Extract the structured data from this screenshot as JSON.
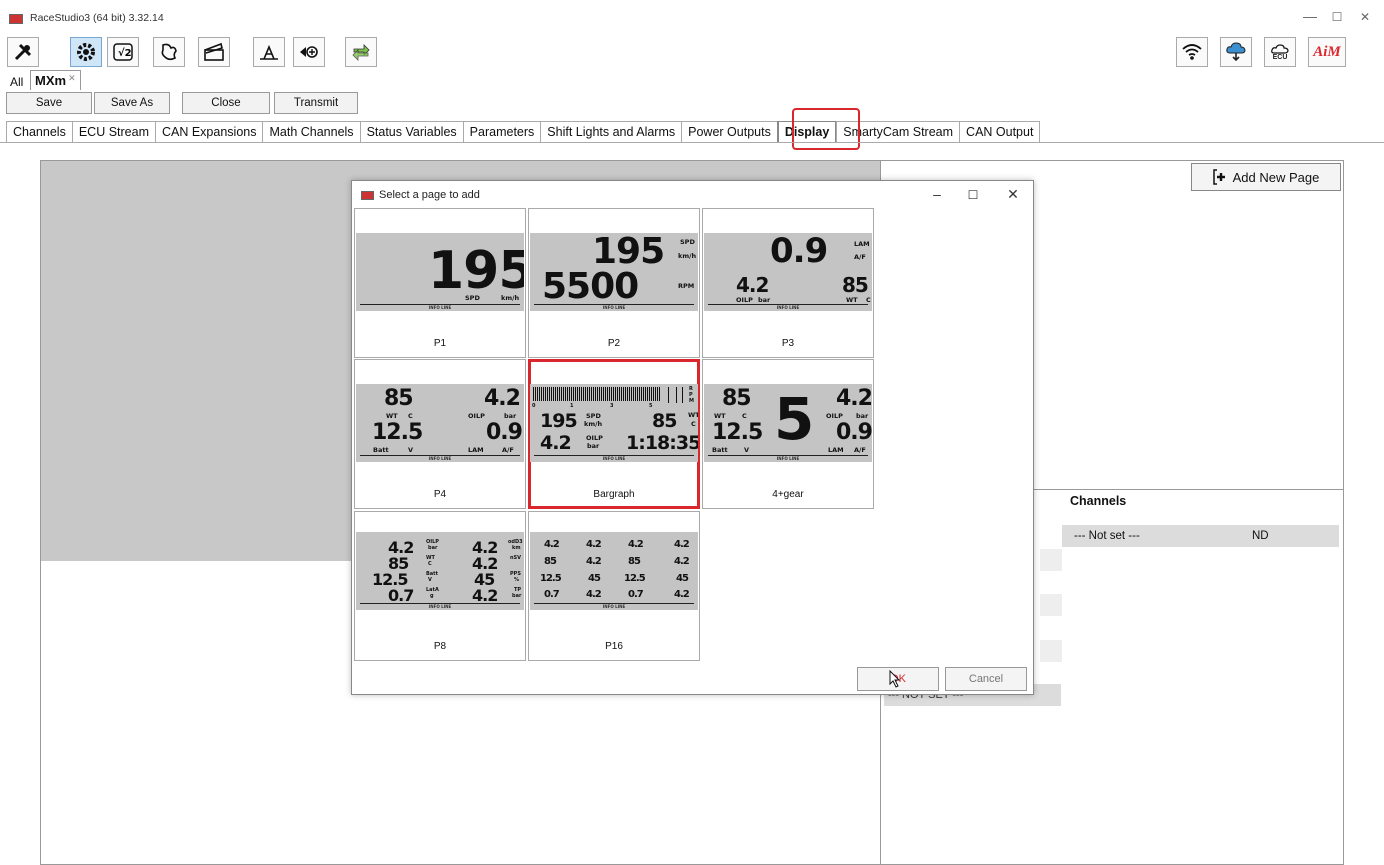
{
  "window": {
    "title": "RaceStudio3 (64 bit) 3.32.14",
    "minimize": "—",
    "maximize": "☐",
    "close": "✕"
  },
  "toolbar": {
    "left_icons": [
      "wrench-screwdriver-icon",
      "gear-icon",
      "math-function-icon",
      "track-map-icon",
      "video-clapper-icon",
      "dashboard-data-icon",
      "add-device-icon",
      "transfer-arrows-icon"
    ],
    "right_icons": [
      "wifi-icon",
      "cloud-download-icon",
      "ecu-cloud-icon",
      "aim-logo"
    ],
    "ecu_label": "ECU",
    "brand": "AiM"
  },
  "doc_tabs": {
    "all": "All",
    "active": "MXm",
    "close": "✕"
  },
  "actions": {
    "save": "Save",
    "save_as": "Save As",
    "close": "Close",
    "transmit": "Transmit"
  },
  "config_tabs": [
    "Channels",
    "ECU Stream",
    "CAN Expansions",
    "Math Channels",
    "Status Variables",
    "Parameters",
    "Shift Lights and Alarms",
    "Power Outputs",
    "Display",
    "SmartyCam Stream",
    "CAN Output"
  ],
  "active_config_tab": "Display",
  "right_panel": {
    "add_page": "Add New Page",
    "channels_title": "Channels",
    "channel_row": {
      "name": "--- Not set ---",
      "value": "ND"
    },
    "not_set": "--- NOT SET ---"
  },
  "dialog": {
    "title": "Select a page to add",
    "ok": "OK",
    "cancel": "Cancel",
    "info_line": "INFO LINE",
    "pages": [
      {
        "label": "P1",
        "selected": false
      },
      {
        "label": "P2",
        "selected": false
      },
      {
        "label": "P3",
        "selected": false
      },
      {
        "label": "P4",
        "selected": false
      },
      {
        "label": "Bargraph",
        "selected": true
      },
      {
        "label": "4+gear",
        "selected": false
      },
      {
        "label": "P8",
        "selected": false
      },
      {
        "label": "P16",
        "selected": false
      }
    ],
    "p1": {
      "value": "195",
      "u1": "SPD",
      "u2": "km/h"
    },
    "p2": {
      "v1": "195",
      "v2": "5500",
      "u1": "SPD",
      "u2": "km/h",
      "u3": "RPM"
    },
    "p3": {
      "v1": "0.9",
      "v2": "4.2",
      "v3": "85",
      "u1": "LAM",
      "u2": "A/F",
      "u3": "OILP",
      "u4": "bar",
      "u5": "WT",
      "u6": "C"
    },
    "p4": {
      "a": "85",
      "au": "WT",
      "au2": "C",
      "b": "4.2",
      "bu": "OILP",
      "bu2": "bar",
      "c": "12.5",
      "cu": "Batt",
      "cu2": "V",
      "d": "0.9",
      "du": "LAM",
      "du2": "A/F"
    },
    "bargraph": {
      "ticks": [
        "0",
        "1",
        "3",
        "5"
      ],
      "rpm": "R\nP\nM",
      "a": "195",
      "au": "SPD",
      "au2": "km/h",
      "b": "85",
      "bu": "WT",
      "bu2": "C",
      "c": "4.2",
      "cu": "OILP",
      "cu2": "bar",
      "d": "1:18:35"
    },
    "gear": {
      "a": "85",
      "au": "WT",
      "au2": "C",
      "gear": "5",
      "b": "4.2",
      "bu": "OILP",
      "bu2": "bar",
      "c": "12.5",
      "cu": "Batt",
      "cu2": "V",
      "d": "0.9",
      "du": "LAM",
      "du2": "A/F"
    },
    "p8": {
      "rows": [
        {
          "l": "4.2",
          "lu": "OILP",
          "lu2": "bar",
          "r": "4.2",
          "ru": "odD3",
          "ru2": "km"
        },
        {
          "l": "85",
          "lu": "WT",
          "lu2": "C",
          "r": "4.2",
          "ru": "nSV",
          "ru2": ""
        },
        {
          "l": "12.5",
          "lu": "Batt",
          "lu2": "V",
          "r": "45",
          "ru": "PPS",
          "ru2": "%"
        },
        {
          "l": "0.7",
          "lu": "LatA",
          "lu2": "g",
          "r": "4.2",
          "ru": "TP",
          "ru2": "bar"
        }
      ]
    },
    "p16": {
      "rows": [
        [
          "4.2",
          "4.2",
          "4.2",
          "4.2"
        ],
        [
          "85",
          "4.2",
          "85",
          "4.2"
        ],
        [
          "12.5",
          "45",
          "12.5",
          "45"
        ],
        [
          "0.7",
          "4.2",
          "0.7",
          "4.2"
        ]
      ]
    }
  }
}
